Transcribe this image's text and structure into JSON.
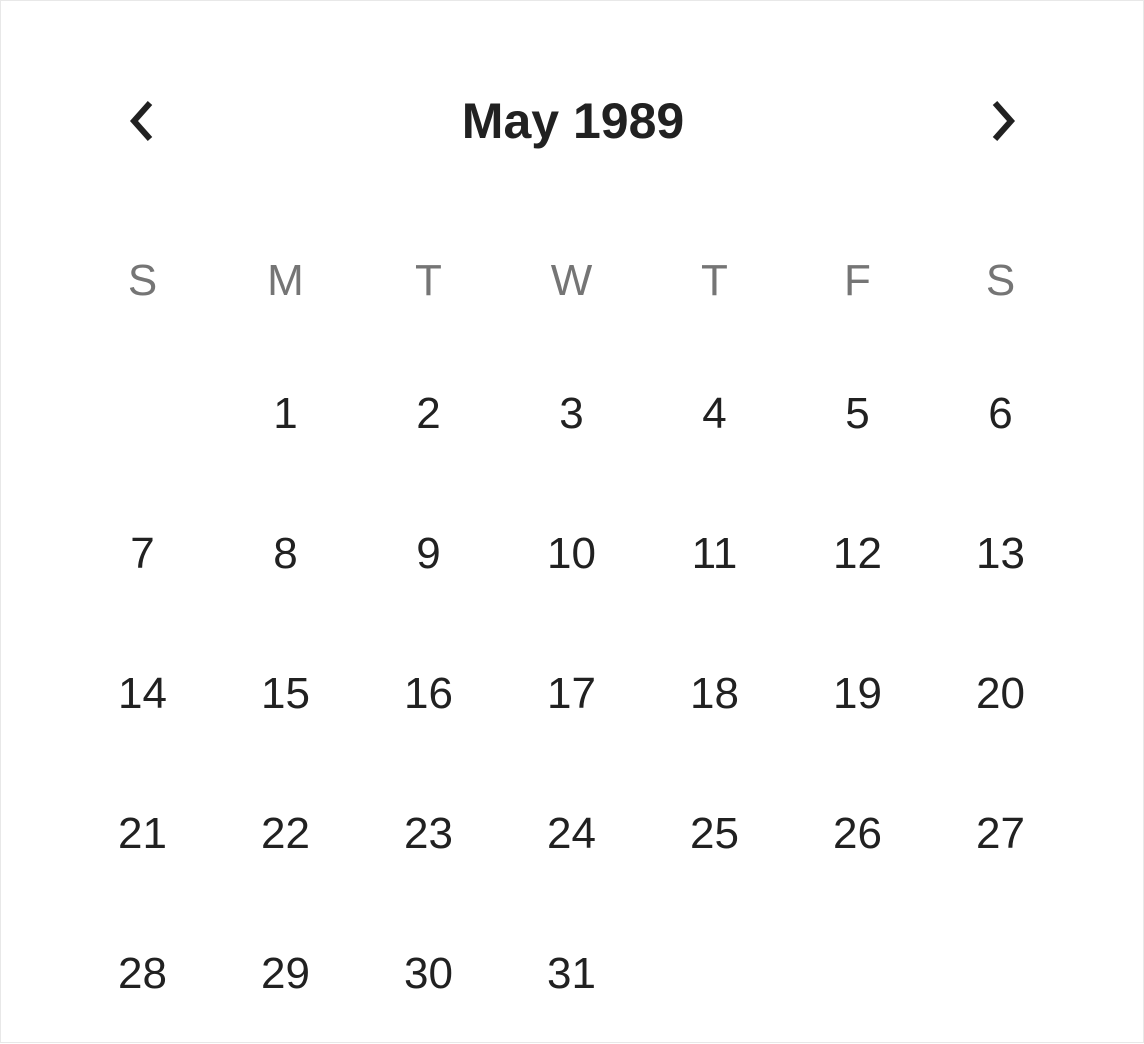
{
  "calendar": {
    "title": "May 1989",
    "prev_icon": "chevron-left-icon",
    "next_icon": "chevron-right-icon",
    "weekdays": [
      "S",
      "M",
      "T",
      "W",
      "T",
      "F",
      "S"
    ],
    "days": [
      "",
      "1",
      "2",
      "3",
      "4",
      "5",
      "6",
      "7",
      "8",
      "9",
      "10",
      "11",
      "12",
      "13",
      "14",
      "15",
      "16",
      "17",
      "18",
      "19",
      "20",
      "21",
      "22",
      "23",
      "24",
      "25",
      "26",
      "27",
      "28",
      "29",
      "30",
      "31",
      "",
      "",
      ""
    ]
  },
  "colors": {
    "text": "#212121",
    "weekday_text": "#757575",
    "background": "#ffffff"
  }
}
